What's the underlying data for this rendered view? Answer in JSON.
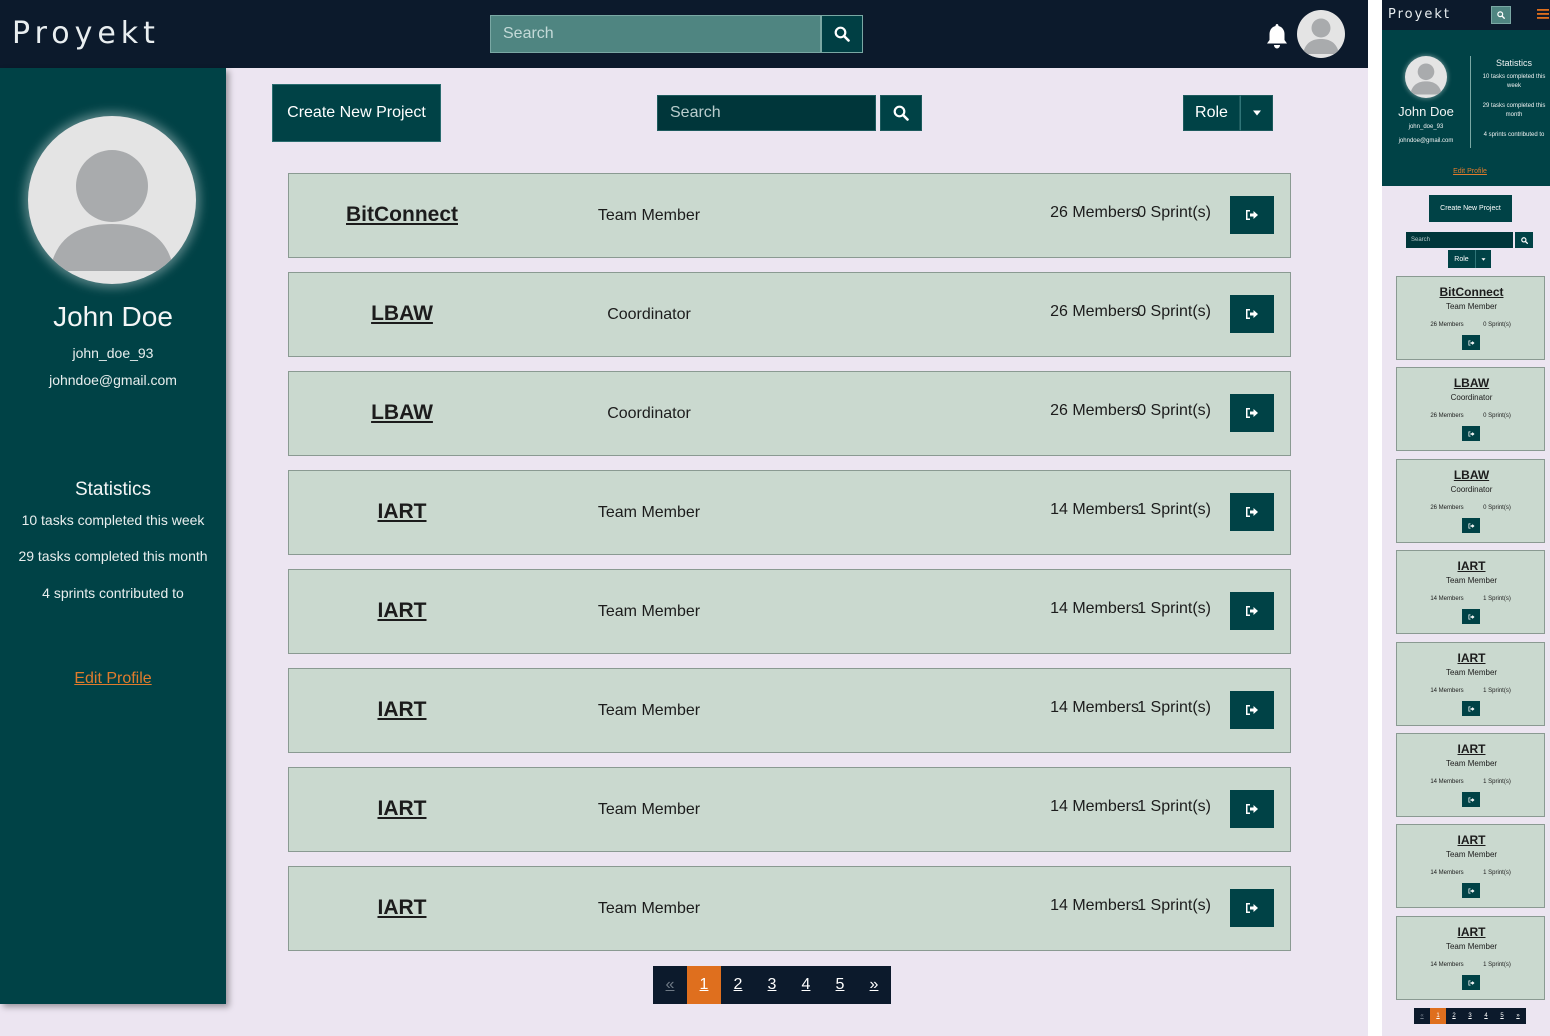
{
  "navbar": {
    "brand": "Proyekt",
    "search_placeholder": "Search"
  },
  "profile": {
    "name": "John Doe",
    "username": "john_doe_93",
    "email": "johndoe@gmail.com",
    "edit_label": "Edit Profile"
  },
  "statistics": {
    "title": "Statistics",
    "lines": [
      "10 tasks completed this week",
      "29 tasks completed this month",
      "4 sprints contributed to"
    ]
  },
  "toolbar": {
    "create_label": "Create New Project",
    "search_placeholder": "Search",
    "role_label": "Role"
  },
  "projects": [
    {
      "name": "BitConnect",
      "role": "Team Member",
      "members": "26 Members",
      "sprints": "0 Sprint(s)"
    },
    {
      "name": "LBAW",
      "role": "Coordinator",
      "members": "26 Members",
      "sprints": "0 Sprint(s)"
    },
    {
      "name": "LBAW",
      "role": "Coordinator",
      "members": "26 Members",
      "sprints": "0 Sprint(s)"
    },
    {
      "name": "IART",
      "role": "Team Member",
      "members": "14 Members",
      "sprints": "1 Sprint(s)"
    },
    {
      "name": "IART",
      "role": "Team Member",
      "members": "14 Members",
      "sprints": "1 Sprint(s)"
    },
    {
      "name": "IART",
      "role": "Team Member",
      "members": "14 Members",
      "sprints": "1 Sprint(s)"
    },
    {
      "name": "IART",
      "role": "Team Member",
      "members": "14 Members",
      "sprints": "1 Sprint(s)"
    },
    {
      "name": "IART",
      "role": "Team Member",
      "members": "14 Members",
      "sprints": "1 Sprint(s)"
    }
  ],
  "pagination": {
    "prev": "«",
    "pages": [
      "1",
      "2",
      "3",
      "4",
      "5"
    ],
    "next": "»",
    "active_page": "1"
  },
  "icons": {
    "search": "search-icon",
    "bell": "bell-icon",
    "avatar": "user-avatar-icon",
    "caret": "caret-down-icon",
    "enter": "sign-out-icon",
    "menu": "hamburger-menu-icon"
  },
  "colors": {
    "navbar": "#0c1a2c",
    "sidebar": "#004246",
    "background": "#ece5f1",
    "card": "#cad9cf",
    "accent": "#df6f1e",
    "link": "#e07b2c"
  }
}
